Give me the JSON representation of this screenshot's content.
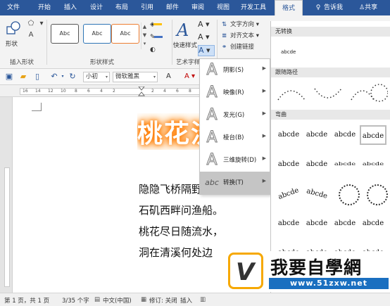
{
  "tabs": [
    {
      "label": "文件",
      "active": false
    },
    {
      "label": "开始",
      "active": false
    },
    {
      "label": "插入",
      "active": false
    },
    {
      "label": "设计",
      "active": false
    },
    {
      "label": "布局",
      "active": false
    },
    {
      "label": "引用",
      "active": false
    },
    {
      "label": "邮件",
      "active": false
    },
    {
      "label": "审阅",
      "active": false
    },
    {
      "label": "视图",
      "active": false
    },
    {
      "label": "开发工具",
      "active": false
    },
    {
      "label": "格式",
      "active": true
    }
  ],
  "tellme": "告诉我",
  "share": "共享",
  "ribbon": {
    "shape_label": "形状",
    "group_insert_shape": "插入形状",
    "group_shape_styles": "形状样式",
    "style_samples": [
      "Abc",
      "Abc",
      "Abc"
    ],
    "style_colors": [
      "#555555",
      "#2e75b6",
      "#ed7d31"
    ],
    "quick_styles_label": "快速样式",
    "group_wordart": "艺术字样",
    "text_direction": "文字方向",
    "align_text": "对齐文本",
    "create_link": "创建链接"
  },
  "qat": {
    "font_size": "小初",
    "font_name": "微软雅黑"
  },
  "ruler_numbers": [
    "16",
    "14",
    "12",
    "10",
    "8",
    "6",
    "4",
    "2",
    "2",
    "4",
    "6",
    "8",
    "10",
    "12",
    "14"
  ],
  "document": {
    "wordart_text": "桃花流",
    "poem_lines": [
      "隐隐飞桥隔野烟，",
      "石矶西畔问渔船。",
      "桃花尽日随流水，",
      "洞在清溪何处边"
    ]
  },
  "effects_menu": [
    {
      "label": "阴影(S)",
      "icon": "shadow-effect-icon"
    },
    {
      "label": "映像(R)",
      "icon": "reflection-effect-icon"
    },
    {
      "label": "发光(G)",
      "icon": "glow-effect-icon"
    },
    {
      "label": "棱台(B)",
      "icon": "bevel-effect-icon"
    },
    {
      "label": "三维旋转(D)",
      "icon": "3d-rotation-effect-icon"
    },
    {
      "label": "转换(T)",
      "icon": "transform-effect-icon",
      "active": true
    }
  ],
  "transform_panel": {
    "no_transform_heading": "无转换",
    "no_transform_sample": "abcde",
    "follow_path_heading": "跟随路径",
    "warp_heading": "弯曲",
    "sample": "abcde"
  },
  "watermark": {
    "title": "我要自學網",
    "url": "www.51zxw.net"
  },
  "status": {
    "page": "第 1 页，共 1 页",
    "words": "3/35 个字",
    "language": "中文(中国)",
    "revisions": "修订: 关闭",
    "mode": "插入"
  }
}
